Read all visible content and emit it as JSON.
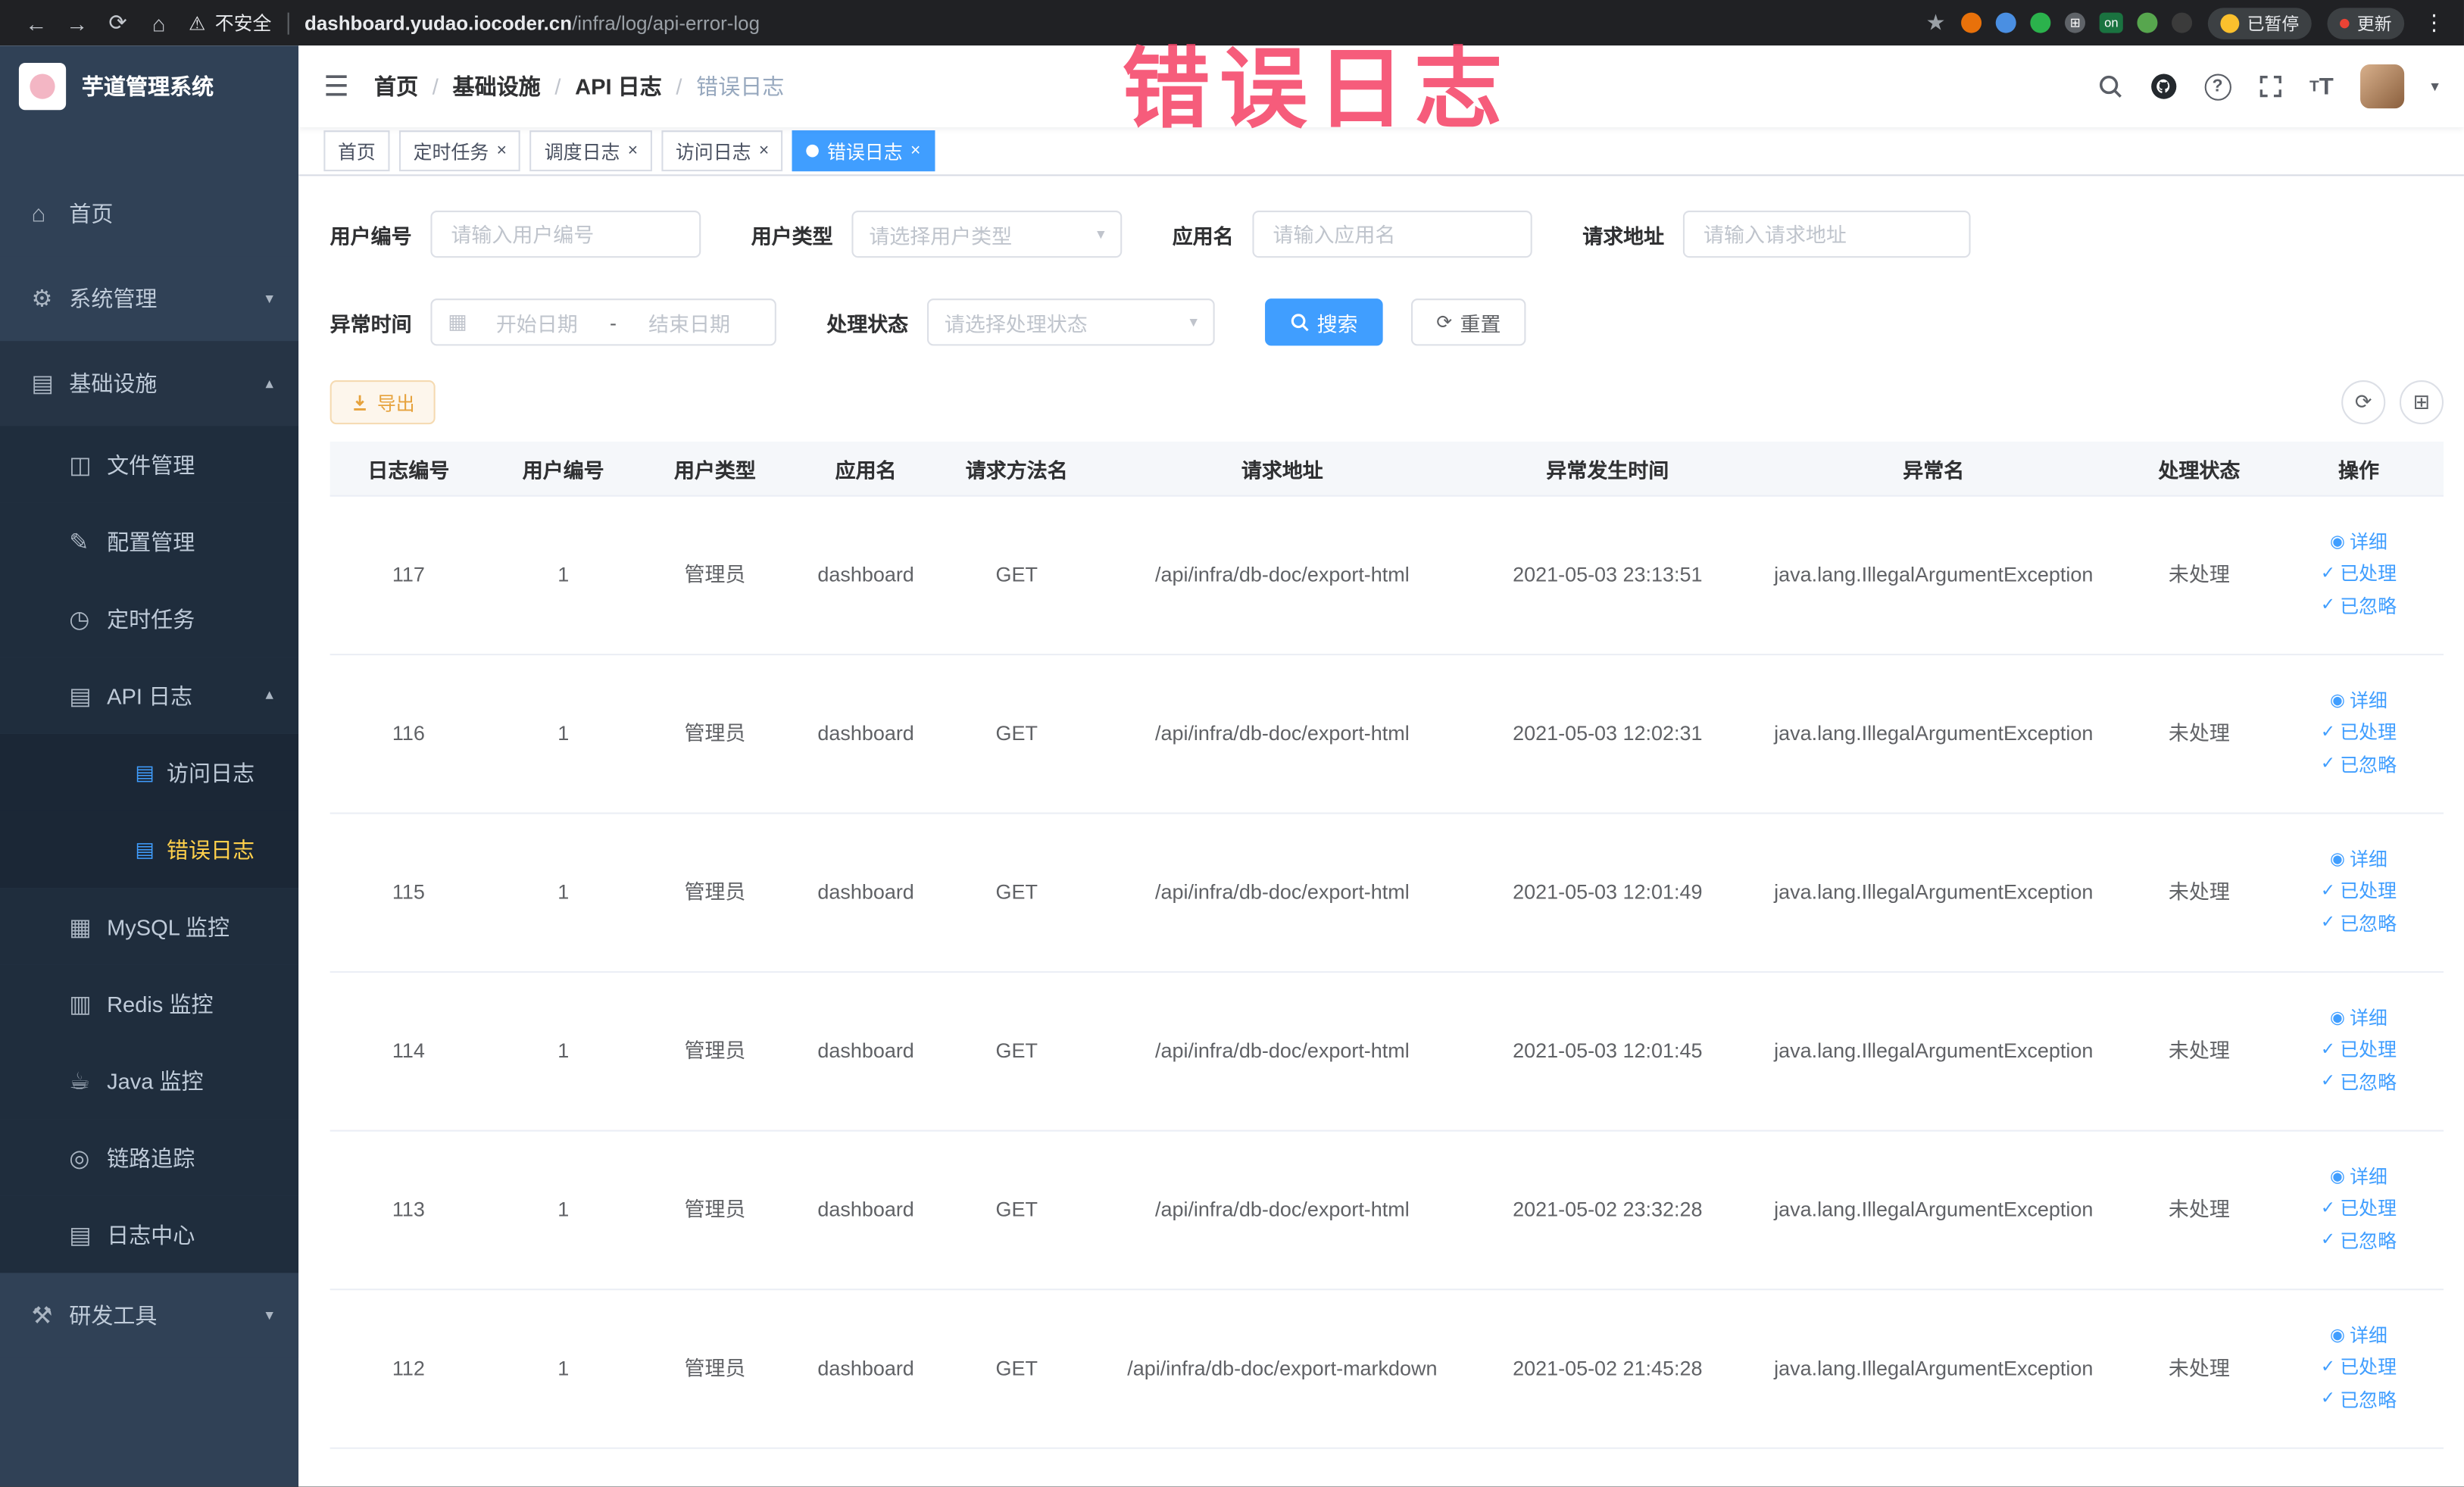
{
  "colors": {
    "chrome-bg": "#202124",
    "accent": "#409eff",
    "active-yellow": "#ffd04b",
    "sidebar-bg": "#304156",
    "submenu-bg": "#1f2d3d",
    "submenu2-bg": "#1b2736",
    "sidebar-text": "#bfcbd9",
    "warning": "#e6a23c",
    "warning-bg": "#fdf6ec",
    "warning-border": "#f5dab1",
    "border": "#dcdfe6",
    "placeholder": "#bfc4cc",
    "thead-bg": "#f5f7fa",
    "table-border": "#ebeef5",
    "annotation": "rgba(245,70,105,0.88)"
  },
  "browser": {
    "security_label": "不安全",
    "url_host": "dashboard.yudao.iocoder.cn",
    "url_path": "/infra/log/api-error-log",
    "extensions": [
      {
        "icon": "extension-orange-icon",
        "color": "#e8710a"
      },
      {
        "icon": "extension-blue-icon",
        "color": "#4a8fe2"
      },
      {
        "icon": "extension-green-icon",
        "color": "#2bb24c"
      },
      {
        "icon": "extension-grid-icon",
        "color": "#5f6368",
        "text": "⊞"
      },
      {
        "icon": "extension-on-badge-icon",
        "color": "#1a7340",
        "text": "on",
        "square": true
      },
      {
        "icon": "extension-leaf-icon",
        "color": "#57a64e"
      },
      {
        "icon": "extension-paw-icon",
        "color": "#3b3b3b"
      }
    ],
    "paused_badge": "已暂停",
    "update_label": "更新"
  },
  "annotation": {
    "text": "错误日志"
  },
  "sidebar": {
    "logo_title": "芋道管理系统",
    "items": [
      {
        "name": "sidebar-item-home",
        "label": "首页",
        "icon": "home-icon",
        "glyph": "⌂",
        "level": 1
      },
      {
        "name": "sidebar-item-system",
        "label": "系统管理",
        "icon": "gear-icon",
        "glyph": "⚙",
        "level": 1,
        "arrow": "▾"
      },
      {
        "name": "sidebar-item-infrastructure",
        "label": "基础设施",
        "icon": "infrastructure-icon",
        "glyph": "▤",
        "level": 1,
        "arrow": "▴",
        "open": true
      },
      {
        "name": "sidebar-item-file-manage",
        "label": "文件管理",
        "icon": "file-icon",
        "glyph": "◫",
        "level": 2
      },
      {
        "name": "sidebar-item-config-manage",
        "label": "配置管理",
        "icon": "edit-icon",
        "glyph": "✎",
        "level": 2
      },
      {
        "name": "sidebar-item-scheduled-jobs",
        "label": "定时任务",
        "icon": "clock-icon",
        "glyph": "◷",
        "level": 2
      },
      {
        "name": "sidebar-item-api-log",
        "label": "API 日志",
        "icon": "log-icon",
        "glyph": "▤",
        "level": 2,
        "arrow": "▴"
      },
      {
        "name": "sidebar-item-access-log",
        "label": "访问日志",
        "icon": "document-icon",
        "glyph": "▤",
        "level": 3,
        "blue": true
      },
      {
        "name": "sidebar-item-error-log",
        "label": "错误日志",
        "icon": "document-icon",
        "glyph": "▤",
        "level": 3,
        "blue": true,
        "active": true
      },
      {
        "name": "sidebar-item-mysql-monitor",
        "label": "MySQL 监控",
        "icon": "database-icon",
        "glyph": "▦",
        "level": 2
      },
      {
        "name": "sidebar-item-redis-monitor",
        "label": "Redis 监控",
        "icon": "database-icon",
        "glyph": "▥",
        "level": 2
      },
      {
        "name": "sidebar-item-java-monitor",
        "label": "Java 监控",
        "icon": "coffee-icon",
        "glyph": "☕",
        "level": 2
      },
      {
        "name": "sidebar-item-tracing",
        "label": "链路追踪",
        "icon": "trace-icon",
        "glyph": "◎",
        "level": 2
      },
      {
        "name": "sidebar-item-log-center",
        "label": "日志中心",
        "icon": "log-icon",
        "glyph": "▤",
        "level": 2
      },
      {
        "name": "sidebar-item-dev-tools",
        "label": "研发工具",
        "icon": "tools-icon",
        "glyph": "⚒",
        "level": 1,
        "arrow": "▾"
      }
    ]
  },
  "header": {
    "breadcrumb": [
      "首页",
      "基础设施",
      "API 日志",
      "错误日志"
    ]
  },
  "tabs": [
    {
      "label": "首页",
      "closable": false,
      "active": false
    },
    {
      "label": "定时任务",
      "closable": true,
      "active": false
    },
    {
      "label": "调度日志",
      "closable": true,
      "active": false
    },
    {
      "label": "访问日志",
      "closable": true,
      "active": false
    },
    {
      "label": "错误日志",
      "closable": true,
      "active": true
    }
  ],
  "filters": {
    "user_id": {
      "label": "用户编号",
      "placeholder": "请输入用户编号"
    },
    "user_type": {
      "label": "用户类型",
      "placeholder": "请选择用户类型"
    },
    "app_name": {
      "label": "应用名",
      "placeholder": "请输入应用名"
    },
    "request_url": {
      "label": "请求地址",
      "placeholder": "请输入请求地址"
    },
    "exception_time": {
      "label": "异常时间",
      "start_placeholder": "开始日期",
      "separator": "-",
      "end_placeholder": "结束日期"
    },
    "process_status": {
      "label": "处理状态",
      "placeholder": "请选择处理状态"
    },
    "search_label": "搜索",
    "reset_label": "重置"
  },
  "toolbar": {
    "export_label": "导出"
  },
  "table": {
    "columns": [
      "日志编号",
      "用户编号",
      "用户类型",
      "应用名",
      "请求方法名",
      "请求地址",
      "异常发生时间",
      "异常名",
      "处理状态",
      "操作"
    ],
    "actions": [
      "详细",
      "已处理",
      "已忽略"
    ],
    "rows": [
      {
        "id": "117",
        "user_id": "1",
        "user_type": "管理员",
        "app": "dashboard",
        "method": "GET",
        "url": "/api/infra/db-doc/export-html",
        "time": "2021-05-03 23:13:51",
        "exception": "java.lang.IllegalArgumentException",
        "status": "未处理"
      },
      {
        "id": "116",
        "user_id": "1",
        "user_type": "管理员",
        "app": "dashboard",
        "method": "GET",
        "url": "/api/infra/db-doc/export-html",
        "time": "2021-05-03 12:02:31",
        "exception": "java.lang.IllegalArgumentException",
        "status": "未处理"
      },
      {
        "id": "115",
        "user_id": "1",
        "user_type": "管理员",
        "app": "dashboard",
        "method": "GET",
        "url": "/api/infra/db-doc/export-html",
        "time": "2021-05-03 12:01:49",
        "exception": "java.lang.IllegalArgumentException",
        "status": "未处理"
      },
      {
        "id": "114",
        "user_id": "1",
        "user_type": "管理员",
        "app": "dashboard",
        "method": "GET",
        "url": "/api/infra/db-doc/export-html",
        "time": "2021-05-03 12:01:45",
        "exception": "java.lang.IllegalArgumentException",
        "status": "未处理"
      },
      {
        "id": "113",
        "user_id": "1",
        "user_type": "管理员",
        "app": "dashboard",
        "method": "GET",
        "url": "/api/infra/db-doc/export-html",
        "time": "2021-05-02 23:32:28",
        "exception": "java.lang.IllegalArgumentException",
        "status": "未处理"
      },
      {
        "id": "112",
        "user_id": "1",
        "user_type": "管理员",
        "app": "dashboard",
        "method": "GET",
        "url": "/api/infra/db-doc/export-markdown",
        "time": "2021-05-02 21:45:28",
        "exception": "java.lang.IllegalArgumentException",
        "status": "未处理"
      }
    ]
  }
}
